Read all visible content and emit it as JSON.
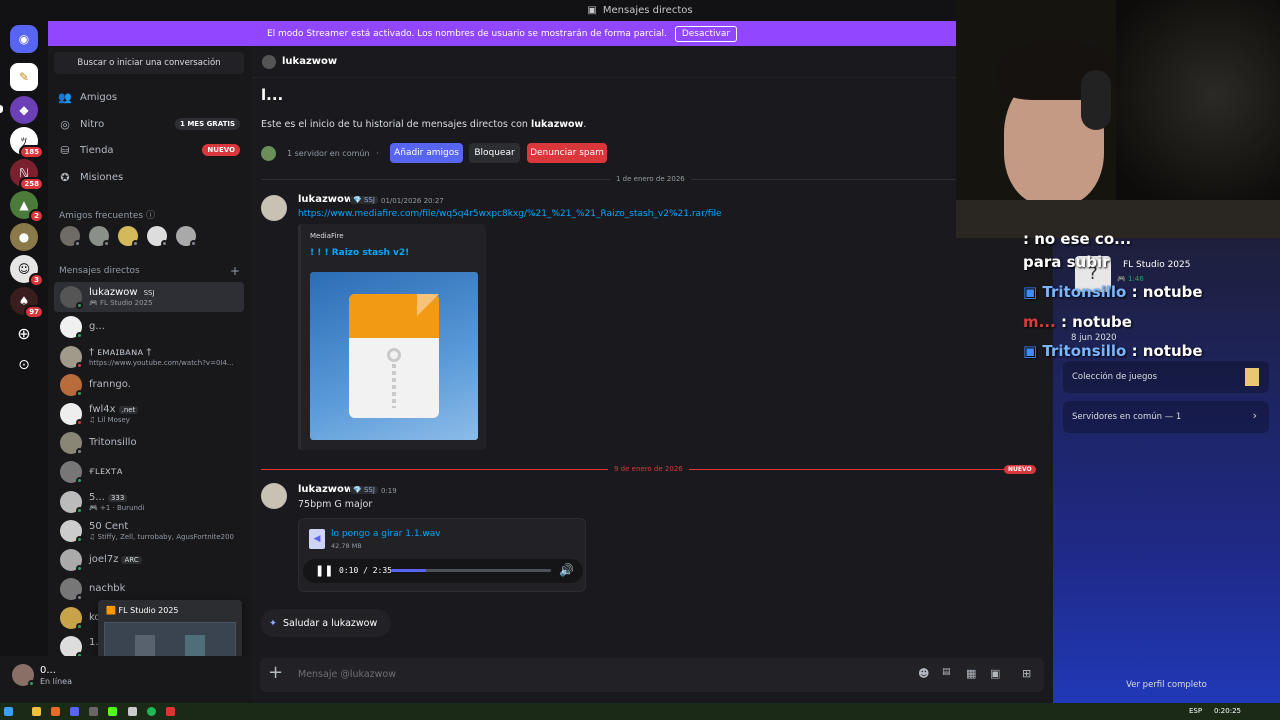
{
  "window": {
    "title": "Mensajes directos"
  },
  "banner": {
    "text": "El modo Streamer está activado. Los nombres de usuario se mostrarán de forma parcial.",
    "button": "Desactivar"
  },
  "server_badges": [
    "185",
    "258",
    "2",
    "3",
    "97"
  ],
  "sidebar": {
    "search": "Buscar o iniciar una conversación",
    "nav": [
      {
        "label": "Amigos"
      },
      {
        "label": "Nitro",
        "tag": "1 MES GRATIS"
      },
      {
        "label": "Tienda",
        "tag": "NUEVO"
      },
      {
        "label": "Misiones"
      }
    ],
    "frequent_title": "Amigos frecuentes",
    "dm_title": "Mensajes directos",
    "dms": [
      {
        "name": "lukazwow",
        "chip": "SSJ",
        "sub": "FL Studio 2025"
      },
      {
        "name": "g...",
        "chip": "",
        "sub": ""
      },
      {
        "name": "† ᴇᴍᴀɪʙᴀɴᴀ †",
        "chip": "",
        "sub": "https://www.youtube.com/watch?v=0I4..."
      },
      {
        "name": "franngo.",
        "chip": "",
        "sub": ""
      },
      {
        "name": "fwl4x",
        "chip": ".net",
        "sub": "Lil Mosey"
      },
      {
        "name": "Tritonsillo",
        "chip": "",
        "sub": ""
      },
      {
        "name": "ғʟᴇхᴛᴀ",
        "chip": "",
        "sub": ""
      },
      {
        "name": "5...",
        "chip": "333",
        "sub": "+1 · Burundi"
      },
      {
        "name": "50 Cent",
        "chip": "",
        "sub": "Stiffy, Zell, turrobaby, AgusFortnite200"
      },
      {
        "name": "joel7z",
        "chip": "ARC",
        "sub": ""
      },
      {
        "name": "nachbk",
        "chip": "",
        "sub": ""
      },
      {
        "name": "ko",
        "chip": "",
        "sub": ""
      },
      {
        "name": "1...",
        "chip": "",
        "sub": ""
      }
    ]
  },
  "popup": {
    "title": "FL Studio 2025"
  },
  "user": {
    "name": "0...",
    "status": "En línea"
  },
  "chat": {
    "header": "lukazwow",
    "intro_title": "l...",
    "intro_text": "Este es el inicio de tu historial de mensajes directos con ",
    "intro_user": "lukazwow",
    "mutual": "1 servidor en común",
    "buttons": {
      "add": "Añadir amigos",
      "block": "Bloquear",
      "report": "Denunciar spam"
    },
    "date1": "1 de enero de 2026",
    "msg1": {
      "user": "lukazwow",
      "chip": "SSJ",
      "time": "01/01/2026 20:27",
      "link": "https://www.mediafire.com/file/wq5q4r5wxpc8kxg/%21_%21_%21_Raizo_stash_v2%21.rar/file",
      "embed_provider": "MediaFire",
      "embed_title": "! ! ! Raizo stash v2!"
    },
    "date2": "9 de enero de 2026",
    "new_tag": "NUEVO",
    "msg2": {
      "user": "lukazwow",
      "chip": "SSJ",
      "time": "0:19",
      "text": "75bpm G major",
      "file": "lo pongo a girar 1.1.wav",
      "size": "42.78 MB",
      "player": "0:10 / 2:35",
      "progress": 0.22
    },
    "wave": "Saludar a lukazwow",
    "composer": "Mensaje @lukazwow"
  },
  "profile": {
    "activity": "FL Studio 2025",
    "activity_time": "1:46",
    "since": "8 jun 2020",
    "games": "Colección de juegos",
    "servers": "Servidores en común — 1",
    "full": "Ver perfil completo"
  },
  "overlay_chat": [
    {
      "user": "",
      "text": ": no ese co..."
    },
    {
      "user": "",
      "text": "para subir"
    },
    {
      "user": "Tritonsillo",
      "text": " : notube"
    },
    {
      "user": "m...",
      "text": " : notube"
    },
    {
      "user": "Tritonsillo",
      "text": " : notube"
    }
  ],
  "taskbar": {
    "lang": "ESP",
    "clock": "0:20:25"
  }
}
